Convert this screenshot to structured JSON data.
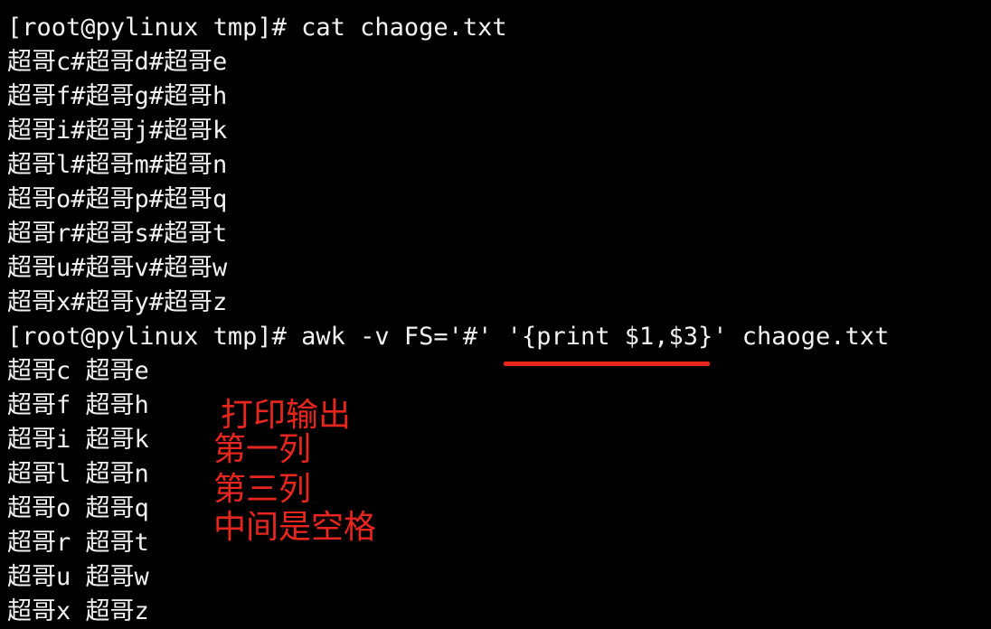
{
  "colors": {
    "background": "#000000",
    "text": "#f2f2f2",
    "annotation": "#e8261e"
  },
  "terminal": {
    "partial_top": "~ ~",
    "lines": [
      "[root@pylinux tmp]# cat chaoge.txt",
      "超哥c#超哥d#超哥e",
      "超哥f#超哥g#超哥h",
      "超哥i#超哥j#超哥k",
      "超哥l#超哥m#超哥n",
      "超哥o#超哥p#超哥q",
      "超哥r#超哥s#超哥t",
      "超哥u#超哥v#超哥w",
      "超哥x#超哥y#超哥z",
      "[root@pylinux tmp]# awk -v FS='#' '{print $1,$3}' chaoge.txt",
      "超哥c 超哥e",
      "超哥f 超哥h",
      "超哥i 超哥k",
      "超哥l 超哥n",
      "超哥o 超哥q",
      "超哥r 超哥t",
      "超哥u 超哥w",
      "超哥x 超哥z"
    ]
  },
  "annotation": {
    "lines": [
      "打印输出",
      "第一列",
      "第三列",
      "中间是空格"
    ]
  }
}
